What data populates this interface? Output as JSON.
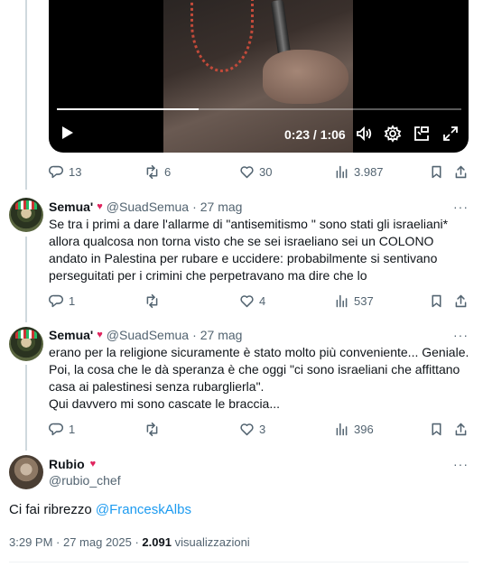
{
  "video": {
    "time": "0:23 / 1:06",
    "progress": 0.35,
    "icons": [
      "play-icon",
      "volume-icon",
      "settings-icon",
      "pip-icon",
      "fullscreen-icon"
    ]
  },
  "first_post_actions": {
    "replies": "13",
    "reposts": "6",
    "likes": "30",
    "views": "3.987"
  },
  "replies": [
    {
      "name": "Semua'",
      "badge": "♥",
      "handle": "@SuadSemua",
      "date": "27 mag",
      "text": "Se tra i primi a dare l'allarme di \"antisemitismo \" sono stati gli israeliani* allora qualcosa non torna visto che se sei israeliano sei un COLONO andato in Palestina per rubare e uccidere: probabilmente si sentivano perseguitati per i crimini che perpetravano ma dire che lo",
      "replies": "1",
      "reposts": "",
      "likes": "4",
      "views": "537"
    },
    {
      "name": "Semua'",
      "badge": "♥",
      "handle": "@SuadSemua",
      "date": "27 mag",
      "lines": [
        "erano per la religione sicuramente è stato molto più conveniente... Geniale.",
        "Poi, la cosa che le dà speranza è che oggi \"ci sono israeliani che affittano casa ai palestinesi senza rubarglierla\".",
        "Qui davvero mi sono cascate le braccia..."
      ],
      "replies": "1",
      "reposts": "",
      "likes": "3",
      "views": "396"
    }
  ],
  "main_post": {
    "name": "Rubio",
    "badge": "♥",
    "handle": "@rubio_chef",
    "text": "Ci fai ribrezzo ",
    "mention": "@FranceskAlbs",
    "time": "3:29 PM · 27 mag 2025 · ",
    "views_count": "2.091",
    "views_label": "visualizzazioni"
  },
  "separator": "·",
  "more_label": "···"
}
